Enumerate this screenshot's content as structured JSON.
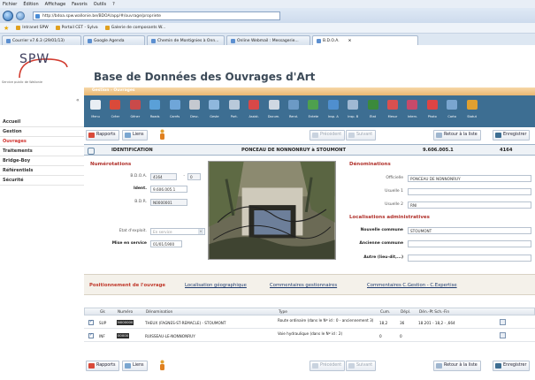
{
  "browser": {
    "menu": [
      "Fichier",
      "Édition",
      "Affichage",
      "Favoris",
      "Outils",
      "?"
    ],
    "url": "http://bdoa.spw.wallonie.be/BDOA/app/#/ouvrage/propriete",
    "favorites": [
      "Intranet SPW",
      "Portail CET - Sylva",
      "Galerie de composants W..."
    ],
    "tabs": [
      {
        "label": "Courrier v7.6.3 (29/01/13)",
        "active": false
      },
      {
        "label": "Google Agenda",
        "active": false
      },
      {
        "label": "Chemin de Montignies à Onn...",
        "active": false
      },
      {
        "label": "Online Webmail : Messagerie...",
        "active": false
      },
      {
        "label": "B.D.O.A.",
        "active": true
      }
    ]
  },
  "app": {
    "logo": "SPW",
    "logo_subtitle": "Service public de Wallonie",
    "title": "Base de Données des Ouvrages d'Art",
    "breadcrumb": "Gestion › Ouvrages"
  },
  "leftnav": {
    "items": [
      {
        "label": "Accueil",
        "selected": false
      },
      {
        "label": "Gestion",
        "selected": false
      },
      {
        "label": "Ouvrages",
        "selected": true
      },
      {
        "label": "Traitements",
        "selected": false
      },
      {
        "label": "Bridge-Boy",
        "selected": false
      },
      {
        "label": "Référentiels",
        "selected": false
      },
      {
        "label": "Sécurité",
        "selected": false
      }
    ]
  },
  "toolbar": {
    "buttons": [
      {
        "label": "Menu",
        "icon": "menu-icon",
        "color": "#e9eef4"
      },
      {
        "label": "Créer",
        "icon": "create-icon",
        "color": "#d94a3a"
      },
      {
        "label": "Géner",
        "icon": "generate-icon",
        "color": "#c94a4a"
      },
      {
        "label": "Roads",
        "icon": "roads-icon",
        "color": "#5aa0d8"
      },
      {
        "label": "Carrés",
        "icon": "squares-icon",
        "color": "#6fa6d9"
      },
      {
        "label": "Desc.",
        "icon": "description-icon",
        "color": "#c5c9d0"
      },
      {
        "label": "Geste",
        "icon": "gesture-icon",
        "color": "#8fb7dd"
      },
      {
        "label": "Port.",
        "icon": "port-icon",
        "color": "#b9c9da"
      },
      {
        "label": "Assist.",
        "icon": "assist-icon",
        "color": "#d84848"
      },
      {
        "label": "Docum.",
        "icon": "document-icon",
        "color": "#cfd8e2"
      },
      {
        "label": "Rend.",
        "icon": "render-icon",
        "color": "#6c9ac5"
      },
      {
        "label": "Entete",
        "icon": "header-icon",
        "color": "#4ea04e"
      },
      {
        "label": "Insp. A",
        "icon": "inspection-icon",
        "color": "#4f8fcf"
      },
      {
        "label": "Insp. B",
        "icon": "inspection-b-icon",
        "color": "#9fb9d3"
      },
      {
        "label": "État",
        "icon": "state-icon",
        "color": "#3b8a3b"
      },
      {
        "label": "Mesur",
        "icon": "measure-icon",
        "color": "#d95050"
      },
      {
        "label": "Interv.",
        "icon": "intervention-icon",
        "color": "#c64a6a"
      },
      {
        "label": "Photo",
        "icon": "photo-icon",
        "color": "#dd4444"
      },
      {
        "label": "Carto",
        "icon": "map-icon",
        "color": "#7aa6d0"
      },
      {
        "label": "Statut",
        "icon": "status-icon",
        "color": "#e0a030"
      }
    ]
  },
  "actions": {
    "reports": "Rapports",
    "links": "Liens",
    "previous": "Précédent",
    "next": "Suivant",
    "back_to_list": "Retour à la liste",
    "save": "Enregistrer"
  },
  "identification": {
    "title": "IDENTIFICATION",
    "name": "PONCEAU DE NONNONRUY à STOUMONT",
    "code": "9.606.005.1",
    "number": "4164"
  },
  "numerotation": {
    "title": "Numérotations",
    "bdoa_label": "B.D.O.A.",
    "bdoa_value": "4164",
    "bdoa_suffix": "0",
    "ident_label": "Ident.",
    "ident_value": "9.606.005.1",
    "bdr_label": "B.D.R.",
    "bdr_value": "N0000001"
  },
  "status": {
    "etat_label": "Etat d'exploit.",
    "etat_value": "En service",
    "mise_label": "Mise en service",
    "mise_value": "01/01/1900"
  },
  "denominations": {
    "title": "Dénominations",
    "officielle_label": "Officielle",
    "officielle_value": "PONCEAU DE NONNONRUY",
    "usuelle1_label": "Usuelle 1",
    "usuelle1_value": "",
    "usuelle2_label": "Usuelle 2",
    "usuelle2_value": "RNI"
  },
  "localisations": {
    "title": "Localisations administratives",
    "nouvelle_label": "Nouvelle commune",
    "nouvelle_value": "STOUMONT",
    "ancienne_label": "Ancienne commune",
    "ancienne_value": "",
    "autre_label": "Autre (lieu-dit,...)",
    "autre_value": ""
  },
  "form_tabs": [
    {
      "label": "Positionnement de l'ouvrage",
      "active": true
    },
    {
      "label": "Localisation géographique",
      "active": false
    },
    {
      "label": "Commentaires gestionnaires",
      "active": false
    },
    {
      "label": "Commentaires C.Gestion - C.Expertise",
      "active": false
    }
  ],
  "table": {
    "headers": [
      "Gk",
      "Numéro",
      "Dénomination",
      "Type",
      "Cum.",
      "Dépl.",
      "Dén.-Pt Sch.-Fin"
    ],
    "rows": [
      {
        "gk": "SUP",
        "numero": "N000000",
        "denomination": "THEUX (FAGNES-ST-REMACLE) - STOUMONT",
        "type": "Route ordinaire (dans le Nº id : 0 - anciennement 3)",
        "cum": "18,2",
        "depl": "36",
        "fin": "18.201 - 18,2 - ,664"
      },
      {
        "gk": "INF",
        "numero": "00000",
        "denomination": "RUISSEAU-LE-NONNONRUY",
        "type": "Voie hydraulique (dans le Nº id : 2)",
        "cum": "0",
        "depl": "0",
        "fin": ""
      }
    ]
  }
}
